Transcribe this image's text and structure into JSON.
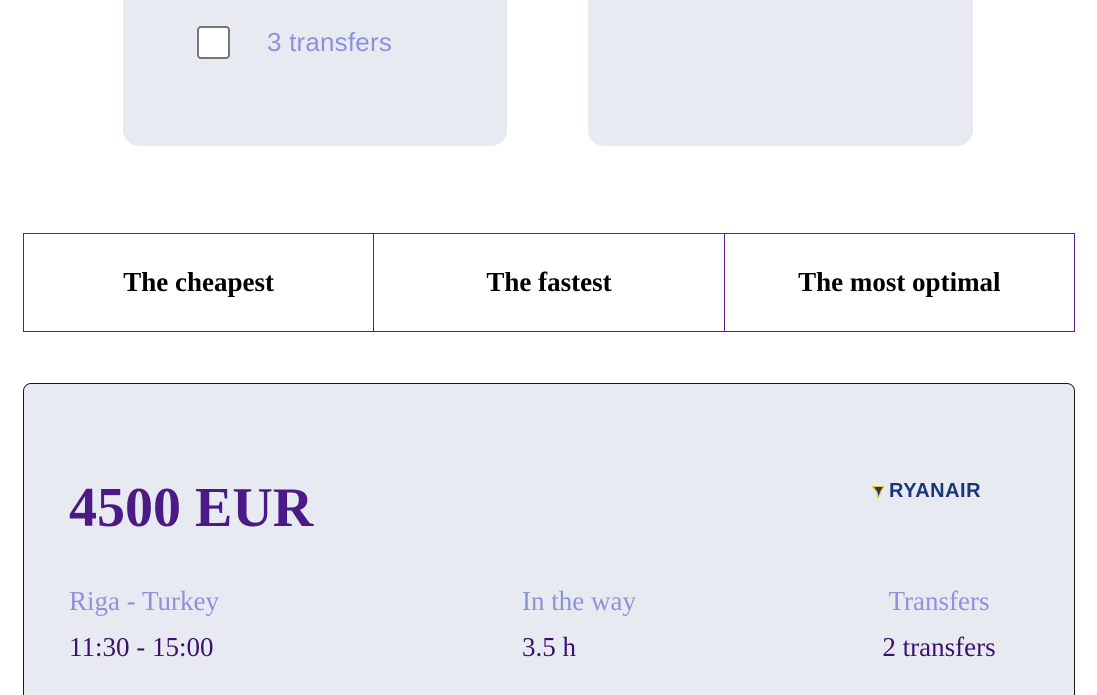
{
  "filters": {
    "transfer_options": [
      {
        "label": "3 transfers",
        "checked": false
      }
    ]
  },
  "sort_tabs": [
    {
      "label": "The cheapest"
    },
    {
      "label": "The fastest"
    },
    {
      "label": "The most optimal"
    }
  ],
  "ticket": {
    "price": "4500 EUR",
    "airline": "RYANAIR",
    "airline_logo_icon": "ryanair-harp-icon",
    "route_label": "Riga - Turkey",
    "time": "11:30 - 15:00",
    "duration_label": "In the way",
    "duration": "3.5 h",
    "transfers_label": "Transfers",
    "transfers": "2 transfers"
  },
  "colors": {
    "panel_background": "#e8eaf2",
    "accent_purple": "#4b1a87",
    "muted_label": "#8c93da",
    "tab_border": "#5a1d8f",
    "ryanair_blue": "#1a3578",
    "ryanair_yellow": "#f1c933"
  }
}
